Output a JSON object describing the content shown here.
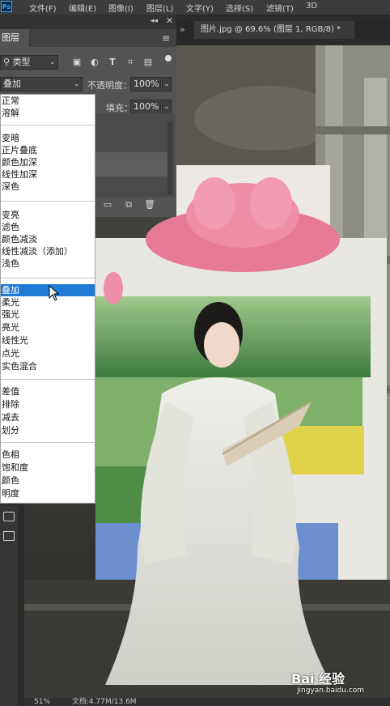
{
  "app": {
    "logo": "Ps",
    "menu": [
      "文件(F)",
      "编辑(E)",
      "图像(I)",
      "图层(L)",
      "文字(Y)",
      "选择(S)",
      "滤镜(T)",
      "3D"
    ]
  },
  "document": {
    "tab_title": "图片.jpg @ 69.6% (图层 1, RGB/8) *"
  },
  "layers_panel": {
    "title": "图层",
    "filter_label": "类型",
    "blend_mode": "叠加",
    "opacity_label": "不透明度：",
    "opacity_value": "100%",
    "fill_label": "填充：",
    "fill_value": "100%"
  },
  "blend_menu": {
    "groups": [
      [
        "正常",
        "溶解"
      ],
      [
        "变暗",
        "正片叠底",
        "颜色加深",
        "线性加深",
        "深色"
      ],
      [
        "变亮",
        "滤色",
        "颜色减淡",
        "线性减淡（添加）",
        "浅色"
      ],
      [
        "叠加",
        "柔光",
        "强光",
        "亮光",
        "线性光",
        "点光",
        "实色混合"
      ],
      [
        "差值",
        "排除",
        "减去",
        "划分"
      ],
      [
        "色相",
        "饱和度",
        "颜色",
        "明度"
      ]
    ],
    "selected": "叠加"
  },
  "status": {
    "zoom": "51%",
    "doc_info": "文档:4.77M/13.6M"
  },
  "watermark": {
    "brand": "Bai 经验",
    "url": "jingyan.baidu.com"
  },
  "colors": {
    "selection": "#1e7bd6",
    "panel": "#535353"
  }
}
